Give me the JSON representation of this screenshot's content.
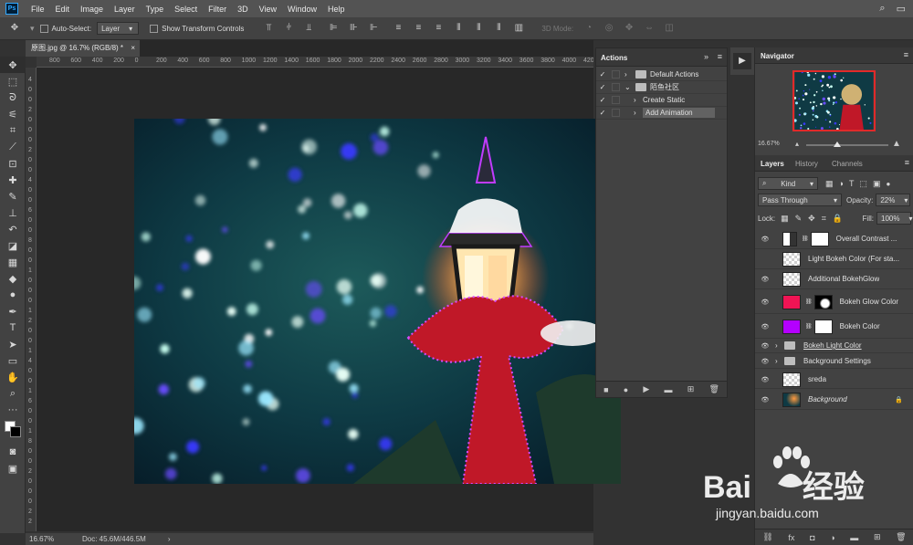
{
  "app": {
    "logo_text": "Ps"
  },
  "menu": [
    "File",
    "Edit",
    "Image",
    "Layer",
    "Type",
    "Select",
    "Filter",
    "3D",
    "View",
    "Window",
    "Help"
  ],
  "options_bar": {
    "auto_select_label": "Auto-Select:",
    "auto_select_value": "Layer",
    "show_transform_label": "Show Transform Controls",
    "mode_3d_label": "3D Mode:"
  },
  "document_tab": {
    "title": "原图.jpg @ 16.7% (RGB/8) *"
  },
  "ruler_top": [
    "800",
    "600",
    "400",
    "200",
    "0",
    "200",
    "400",
    "600",
    "800",
    "1000",
    "1200",
    "1400",
    "1600",
    "1800",
    "2000",
    "2200",
    "2400",
    "2600",
    "2800",
    "3000",
    "3200",
    "3400",
    "3600",
    "3800",
    "4000",
    "420"
  ],
  "ruler_left": [
    "4",
    "0",
    "0",
    "2",
    "0",
    "0",
    "0",
    "2",
    "0",
    "0",
    "4",
    "0",
    "0",
    "6",
    "0",
    "0",
    "8",
    "0",
    "0",
    "1",
    "0",
    "0",
    "0",
    "1",
    "2",
    "0",
    "0",
    "1",
    "4",
    "0",
    "0",
    "1",
    "6",
    "0",
    "0",
    "1",
    "8",
    "0",
    "0",
    "2",
    "0",
    "0",
    "0",
    "2",
    "2"
  ],
  "status_bar": {
    "zoom": "16.67%",
    "doc_info": "Doc: 45.6M/446.5M"
  },
  "actions_panel": {
    "title": "Actions",
    "rows": [
      {
        "label": "Default Actions",
        "checked": true,
        "type": "folder",
        "expanded": false
      },
      {
        "label": "陌鱼社区",
        "checked": true,
        "type": "folder",
        "expanded": true
      },
      {
        "label": "Create Static",
        "checked": true,
        "type": "action",
        "expanded": false
      },
      {
        "label": "Add Animation",
        "checked": true,
        "type": "action",
        "expanded": false,
        "selected": true
      }
    ]
  },
  "navigator": {
    "title": "Navigator",
    "zoom": "16.67%"
  },
  "layers_panel": {
    "tabs": [
      "Layers",
      "History",
      "Channels"
    ],
    "filter_kind": "Kind",
    "blend_mode": "Pass Through",
    "opacity_label": "Opacity:",
    "opacity_value": "22%",
    "lock_label": "Lock:",
    "fill_label": "Fill:",
    "fill_value": "100%",
    "layers": [
      {
        "name": "Overall Contrast ...",
        "visible": true,
        "kind": "adjustment"
      },
      {
        "name": "Light Bokeh Color (For sta...",
        "visible": false,
        "kind": "pixel"
      },
      {
        "name": "Additional BokehGlow",
        "visible": true,
        "kind": "pixel"
      },
      {
        "name": "Bokeh Glow Color",
        "visible": true,
        "kind": "fill-pink"
      },
      {
        "name": "Bokeh Color",
        "visible": true,
        "kind": "fill-purple"
      },
      {
        "name": "Bokeh Light Color",
        "visible": true,
        "kind": "group"
      },
      {
        "name": "Background Settings",
        "visible": true,
        "kind": "group"
      },
      {
        "name": "sreda",
        "visible": true,
        "kind": "pixel"
      },
      {
        "name": "Background",
        "visible": true,
        "kind": "background"
      }
    ]
  },
  "colors": {
    "bokeh_glow": "#f01454",
    "bokeh_purple": "#b400ff",
    "nav_border": "#e02a2a"
  },
  "watermark": {
    "word_left": "Bai",
    "word_right": "经验",
    "url": "jingyan.baidu.com"
  }
}
